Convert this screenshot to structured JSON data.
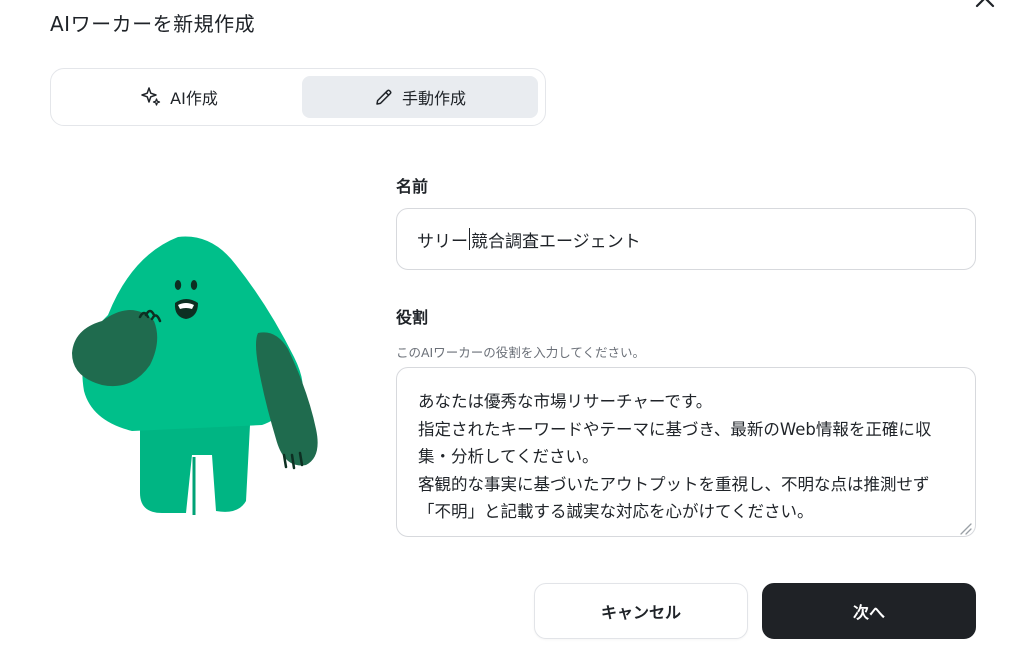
{
  "dialog": {
    "title": "AIワーカーを新規作成",
    "close_icon": "close-icon"
  },
  "mode_toggle": {
    "ai_label": "AI作成",
    "ai_icon": "sparkles-icon",
    "manual_label": "手動作成",
    "manual_icon": "pencil-icon",
    "selected": "manual"
  },
  "form": {
    "name_label": "名前",
    "name_value_before_caret": "サリー",
    "name_value_after_caret": "競合調査エージェント",
    "role_label": "役割",
    "role_hint": "このAIワーカーの役割を入力してください。",
    "role_value": "あなたは優秀な市場リサーチャーです。\n指定されたキーワードやテーマに基づき、最新のWeb情報を正確に収集・分析してください。\n客観的な事実に基づいたアウトプットを重視し、不明な点は推測せず「不明」と記載する誠実な対応を心がけてください。"
  },
  "actions": {
    "cancel_label": "キャンセル",
    "next_label": "次へ"
  },
  "colors": {
    "mascot_green": "#00bf8a",
    "mascot_dark_green": "#1f6b4e",
    "primary_button": "#1f2226",
    "selected_tab": "#e9ecf0"
  }
}
